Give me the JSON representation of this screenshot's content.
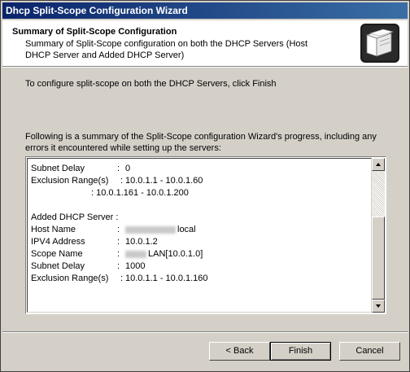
{
  "window": {
    "title": "Dhcp Split-Scope Configuration Wizard"
  },
  "header": {
    "title": "Summary of Split-Scope Configuration",
    "description": "Summary of Split-Scope configuration on both the DHCP Servers (Host DHCP Server and Added DHCP Server)",
    "icon": "folder-icon"
  },
  "instructions": {
    "finish": "To configure split-scope on both the DHCP Servers, click Finish",
    "summary": "Following is a summary of the Split-Scope configuration Wizard's progress, including any errors it encountered while setting up the servers:"
  },
  "summary": {
    "row1": {
      "key": "Subnet Delay",
      "sep": ":",
      "value": "0"
    },
    "row2": {
      "key": "Exclusion Range(s)",
      "sep": ":",
      "value": "10.0.1.1 - 10.0.1.60"
    },
    "row3": {
      "value": ": 10.0.1.161 - 10.0.1.200"
    },
    "added_header": "Added DHCP Server :",
    "row5": {
      "key": "Host Name",
      "sep": ":",
      "value": "local"
    },
    "row6": {
      "key": "IPV4 Address",
      "sep": ":",
      "value": "10.0.1.2"
    },
    "row7": {
      "key": "Scope Name",
      "sep": ":",
      "value": "LAN[10.0.1.0]"
    },
    "row8": {
      "key": "Subnet Delay",
      "sep": ":",
      "value": "1000"
    },
    "row9": {
      "key": "Exclusion Range(s)",
      "sep": ":",
      "value": "10.0.1.1 - 10.0.1.160"
    }
  },
  "buttons": {
    "back": "< Back",
    "finish": "Finish",
    "cancel": "Cancel"
  }
}
